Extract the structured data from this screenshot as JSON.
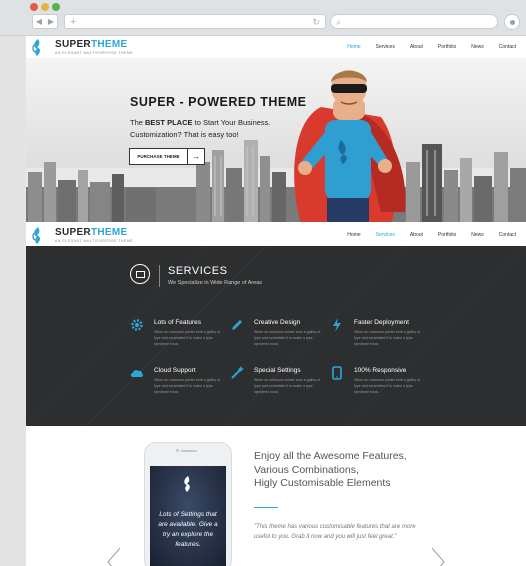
{
  "browser": {
    "dot_colors": [
      "#e2594b",
      "#e9b13f",
      "#56b34b"
    ],
    "back_icon": "back-arrow-icon",
    "forward_icon": "forward-arrow-icon"
  },
  "site": {
    "logo": {
      "text_main": "SUPER",
      "text_accent": "THEME",
      "tagline": "AN ELEGANT MULTIPURPOSE THEME"
    },
    "nav_top": {
      "items": [
        "Home",
        "Services",
        "About",
        "Portfolio",
        "News",
        "Contact"
      ],
      "active": "Home"
    },
    "hero": {
      "title": "SUPER - POWERED THEME",
      "text_prefix": "The ",
      "text_bold": "BEST PLACE",
      "text_rest": " to Start Your Business.",
      "text_line2": "Customization? That is easy too!",
      "cta_label": "PURCHASE THEME",
      "cta_arrow": "→"
    },
    "nav_second": {
      "items": [
        "Home",
        "Services",
        "About",
        "Portfolio",
        "News",
        "Contact"
      ],
      "active": "Services"
    },
    "services": {
      "title": "SERVICES",
      "subtitle": "We Specialize in Wide Range of Areas",
      "features": [
        {
          "title": "Lots of Features",
          "icon": "gear-icon",
          "desc": "When an unknown printer took a galley of type and scrambled it to make a type specimen book."
        },
        {
          "title": "Creative Design",
          "icon": "pencil-icon",
          "desc": "When an unknown printer took a galley of type and scrambled it to make a type specimen book."
        },
        {
          "title": "Faster Deployment",
          "icon": "lightning-icon",
          "desc": "When an unknown printer took a galley of type and scrambled it to make a type specimen book."
        },
        {
          "title": "Cloud Support",
          "icon": "cloud-icon",
          "desc": "When an unknown printer took a galley of type and scrambled it to make a type specimen book."
        },
        {
          "title": "Special Settings",
          "icon": "wand-icon",
          "desc": "When an unknown printer took a galley of type and scrambled it to make a type specimen book."
        },
        {
          "title": "100% Responsive",
          "icon": "tablet-icon",
          "desc": "When an unknown printer took a galley of type and scrambled it to make a type specimen book."
        }
      ]
    },
    "showcase": {
      "title_line1": "Enjoy all the Awesome Features,",
      "title_line2": "Various Combinations,",
      "title_line3": "Higly Customisable Elements",
      "phone_text": "Lots of Settings that are available. Give a try an explore the features.",
      "quote": "\"This theme has various customisable features that are more useful to you. Grab it now and you will just feel great.\""
    },
    "accent_color": "#2aa7d6",
    "dark_color": "#2c2e30"
  }
}
